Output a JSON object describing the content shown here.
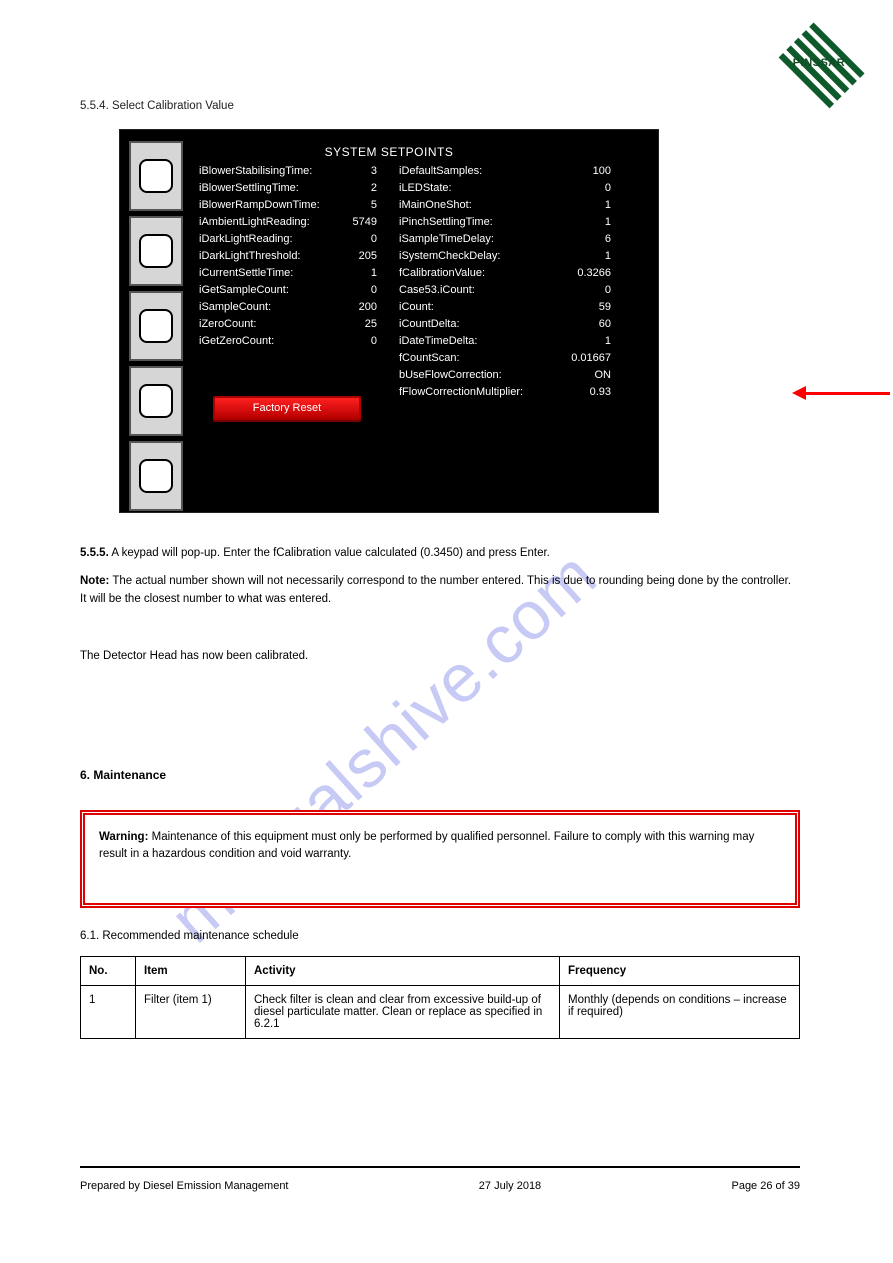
{
  "logo": {
    "label": "PINSSAR"
  },
  "header_line": "5.5.4. Select Calibration Value",
  "screen": {
    "title": "SYSTEM SETPOINTS",
    "left_params": [
      {
        "label": "iBlowerStabilisingTime:",
        "value": "3"
      },
      {
        "label": "iBlowerSettlingTime:",
        "value": "2"
      },
      {
        "label": "iBlowerRampDownTime:",
        "value": "5"
      },
      {
        "label": "iAmbientLightReading:",
        "value": "5749"
      },
      {
        "label": "iDarkLightReading:",
        "value": "0"
      },
      {
        "label": "iDarkLightThreshold:",
        "value": "205"
      },
      {
        "label": "iCurrentSettleTime:",
        "value": "1"
      },
      {
        "label": "iGetSampleCount:",
        "value": "0"
      },
      {
        "label": "iSampleCount:",
        "value": "200"
      },
      {
        "label": "iZeroCount:",
        "value": "25"
      },
      {
        "label": "iGetZeroCount:",
        "value": "0"
      }
    ],
    "right_params": [
      {
        "label": "iDefaultSamples:",
        "value": "100"
      },
      {
        "label": "iLEDState:",
        "value": "0"
      },
      {
        "label": "iMainOneShot:",
        "value": "1"
      },
      {
        "label": "iPinchSettlingTime:",
        "value": "1"
      },
      {
        "label": "iSampleTimeDelay:",
        "value": "6"
      },
      {
        "label": "iSystemCheckDelay:",
        "value": "1"
      },
      {
        "label": "fCalibrationValue:",
        "value": "0.3266"
      },
      {
        "label": "Case53.iCount:",
        "value": "0"
      },
      {
        "label": "iCount:",
        "value": "59"
      },
      {
        "label": "iCountDelta:",
        "value": "60"
      },
      {
        "label": "iDateTimeDelta:",
        "value": "1"
      },
      {
        "label": "fCountScan:",
        "value": "0.01667"
      },
      {
        "label": "bUseFlowCorrection:",
        "value": "ON"
      },
      {
        "label": "fFlowCorrectionMultiplier:",
        "value": "0.93"
      }
    ],
    "button": "Factory Reset"
  },
  "post": {
    "step_num": "5.5.5.",
    "step_text": " A keypad will pop-up. Enter the fCalibration value calculated (0.3450) and press Enter.",
    "note_label": "Note:",
    "note_text": " The actual number shown will not necessarily correspond to the number entered. This is due to rounding being done by the controller. It will be the closest number to what was entered.",
    "section6": "The Detector Head has now been calibrated."
  },
  "maintenance": {
    "heading_num": "6.",
    "heading": " Maintenance",
    "warning_label": "Warning:",
    "warning_text": " Maintenance of this equipment must only be performed by qualified personnel. Failure to comply with this warning may result in a hazardous condition and void warranty.",
    "schedule_label": "6.1. Recommended maintenance schedule"
  },
  "table": {
    "headers": [
      "No.",
      "Item",
      "Activity",
      "Frequency"
    ],
    "rows": [
      {
        "no": "1",
        "item": "Filter (item 1)",
        "activity": "Check filter is clean and clear from excessive build-up of diesel particulate matter. Clean or replace as specified in 6.2.1",
        "frequency": "Monthly (depends on conditions – increase if required)"
      }
    ]
  },
  "footer": {
    "left": "Prepared by Diesel Emission Management",
    "center": "27 July 2018",
    "right": "Page 26 of 39"
  },
  "watermark": "manualshive.com"
}
